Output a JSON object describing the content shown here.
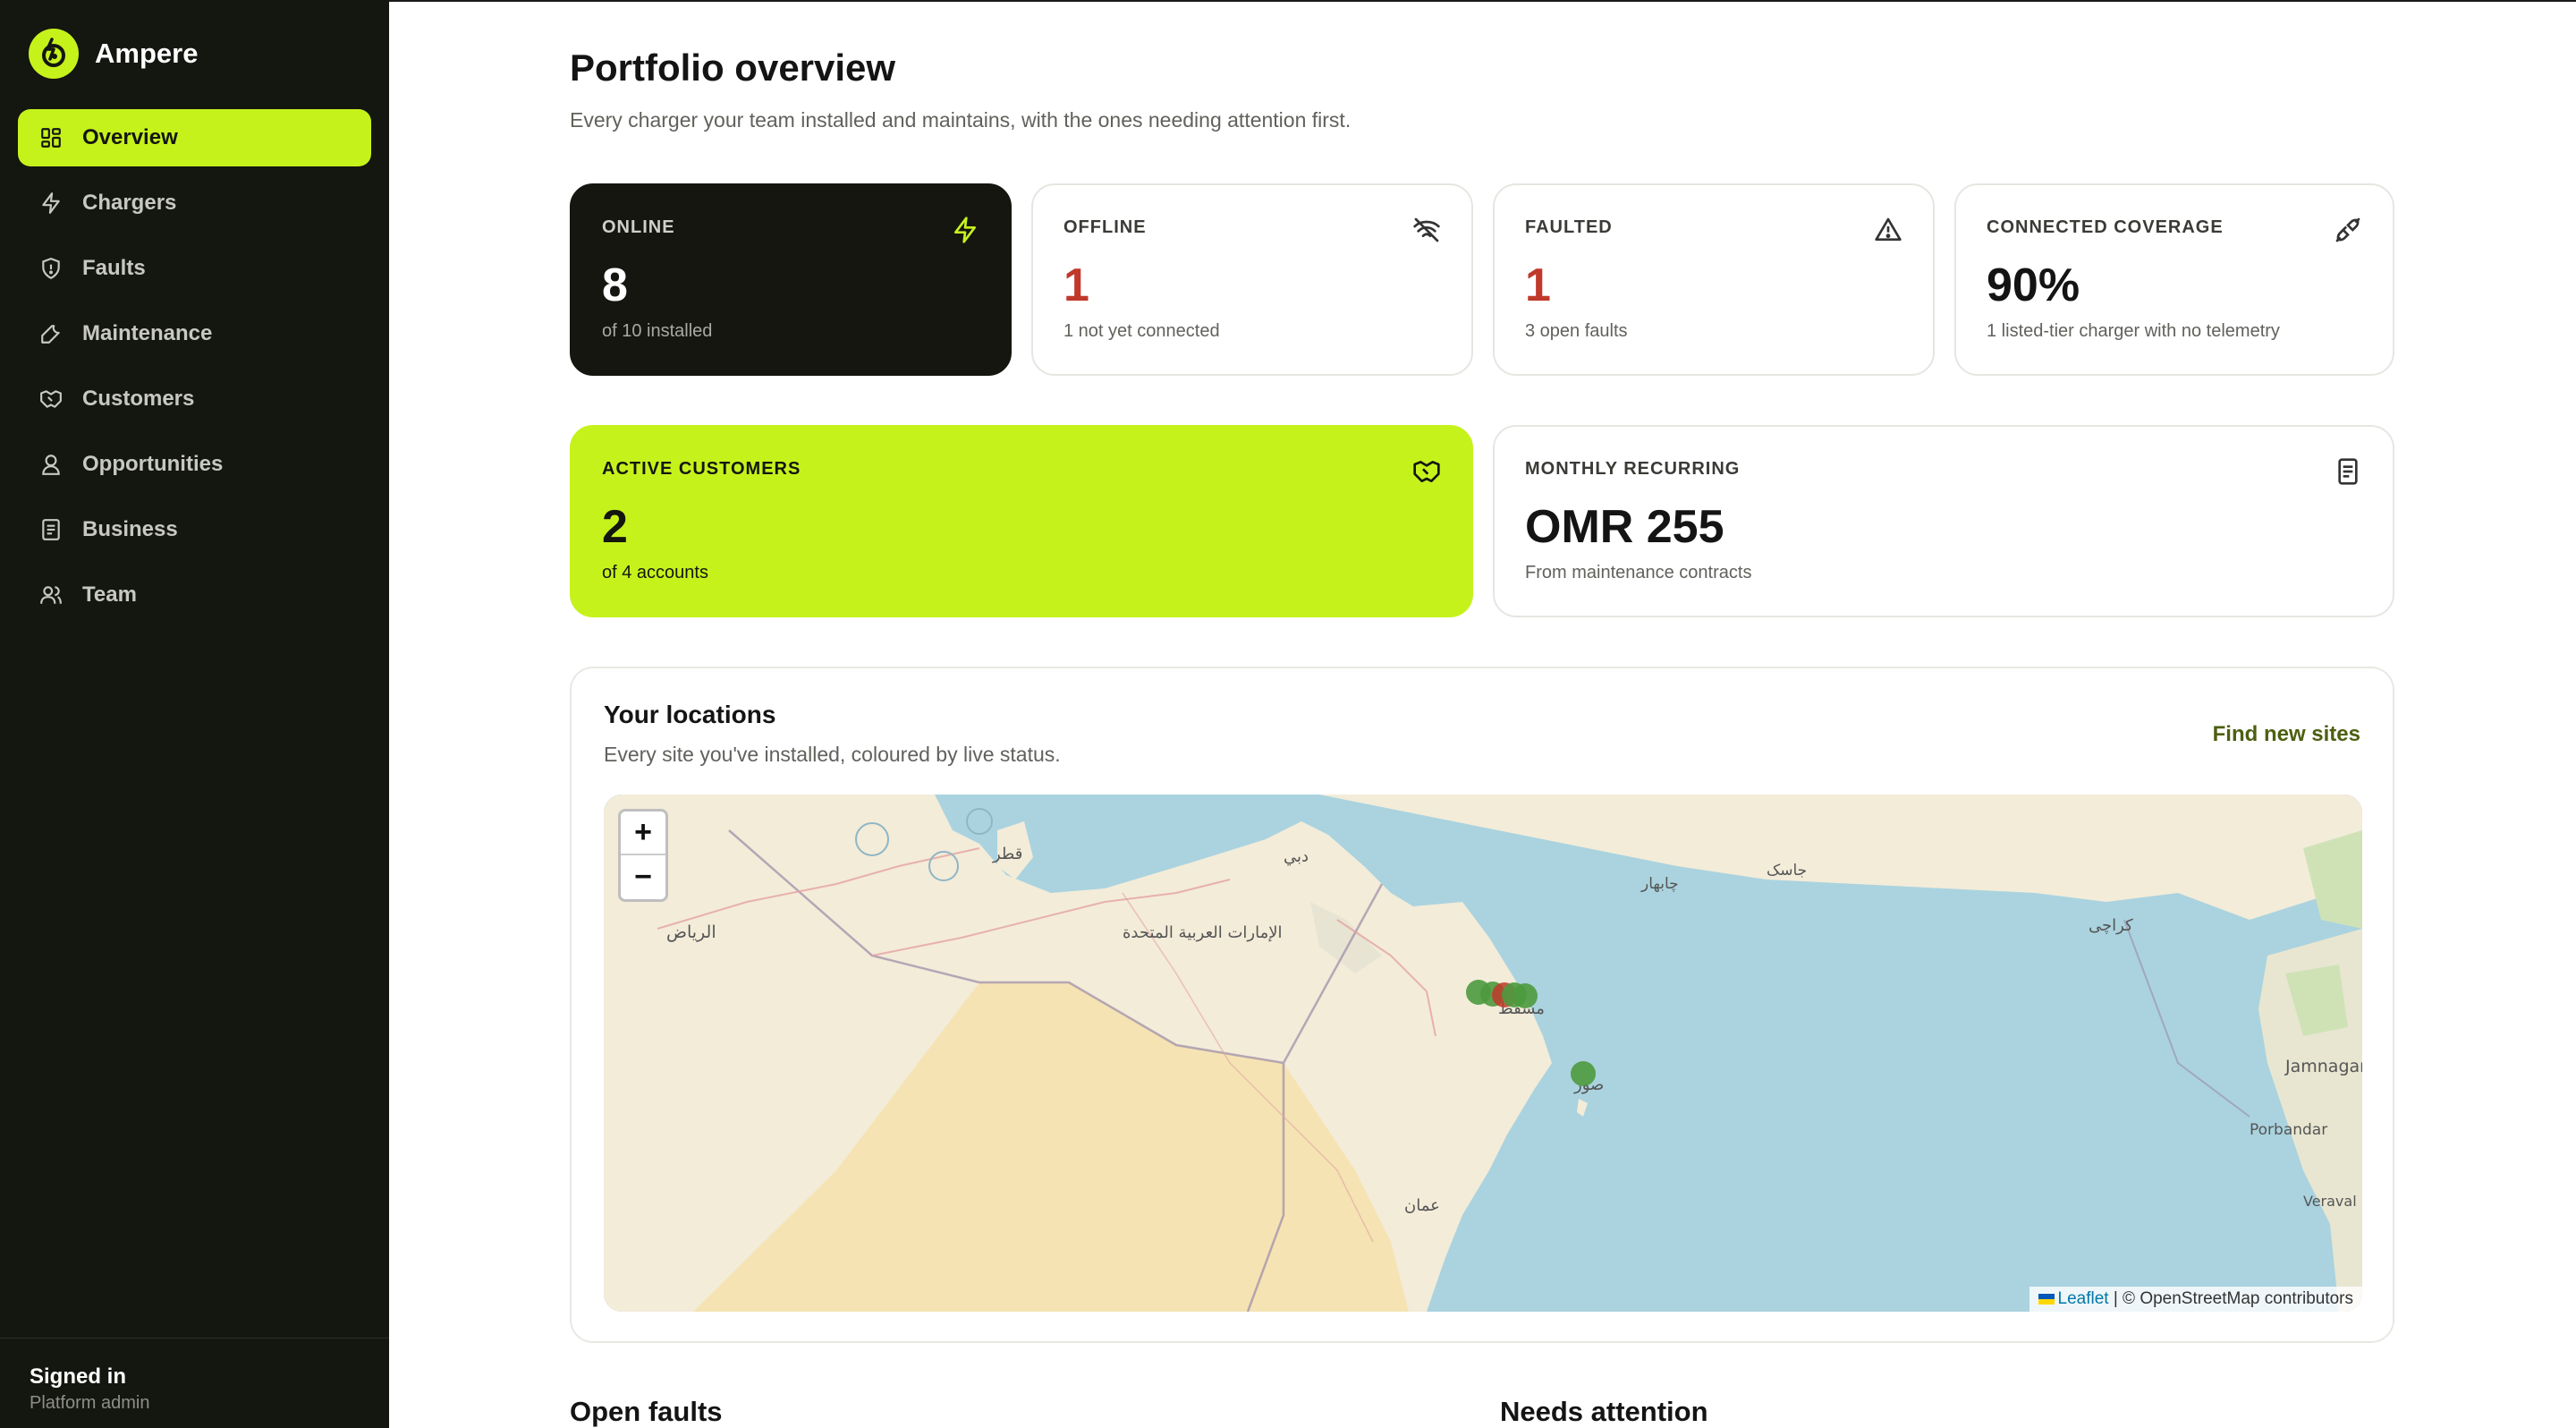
{
  "app": {
    "name": "Ampere"
  },
  "nav": {
    "items": [
      {
        "label": "Overview",
        "icon": "grid-icon",
        "active": true
      },
      {
        "label": "Chargers",
        "icon": "bolt-icon"
      },
      {
        "label": "Faults",
        "icon": "shield-icon"
      },
      {
        "label": "Maintenance",
        "icon": "wrench-icon"
      },
      {
        "label": "Customers",
        "icon": "handshake-icon"
      },
      {
        "label": "Opportunities",
        "icon": "user-badge-icon"
      },
      {
        "label": "Business",
        "icon": "document-icon"
      },
      {
        "label": "Team",
        "icon": "users-icon"
      }
    ]
  },
  "user": {
    "title": "Signed in",
    "role": "Platform admin"
  },
  "page": {
    "title": "Portfolio overview",
    "subtitle": "Every charger your team installed and maintains, with the ones needing attention first."
  },
  "stats": {
    "online": {
      "label": "ONLINE",
      "value": "8",
      "sub": "of 10 installed",
      "icon": "bolt-icon"
    },
    "offline": {
      "label": "OFFLINE",
      "value": "1",
      "sub": "1 not yet connected",
      "icon": "wifi-off-icon"
    },
    "faulted": {
      "label": "FAULTED",
      "value": "1",
      "sub": "3 open faults",
      "icon": "warning-icon"
    },
    "coverage": {
      "label": "CONNECTED COVERAGE",
      "value": "90%",
      "sub": "1 listed-tier charger with no telemetry",
      "icon": "plug-icon"
    },
    "customers": {
      "label": "ACTIVE CUSTOMERS",
      "value": "2",
      "sub": "of 4 accounts",
      "icon": "handshake-icon"
    },
    "recurring": {
      "label": "MONTHLY RECURRING",
      "value": "OMR 255",
      "sub": "From maintenance contracts",
      "icon": "document-icon"
    }
  },
  "locations": {
    "title": "Your locations",
    "subtitle": "Every site you've installed, coloured by live status.",
    "link": "Find new sites",
    "zoom_in": "+",
    "zoom_out": "−",
    "attribution_link": "Leaflet",
    "attribution_text": " | © OpenStreetMap contributors",
    "status_colors": {
      "online": "#4c9a3e",
      "faulted": "#c0392b"
    },
    "map_labels": [
      "الرياض",
      "قطر",
      "الإمارات العربية المتحدة",
      "دبي",
      "مسقط",
      "صور",
      "عمان",
      "كراچی",
      "Jamnagar",
      "Porbandar",
      "Veraval",
      "جاسک",
      "چابهار"
    ]
  },
  "sections": {
    "open_faults": "Open faults",
    "needs_attention": "Needs attention"
  },
  "colors": {
    "accent": "#c6f21c",
    "sidebar": "#141610",
    "danger": "#c0392b"
  }
}
